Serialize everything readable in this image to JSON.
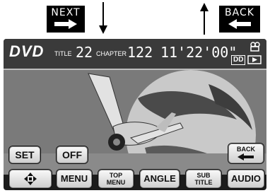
{
  "annotations": {
    "next_label": "NEXT",
    "back_label": "BACK"
  },
  "status_bar": {
    "source": "DVD",
    "title_label": "TITLE",
    "title_number": "22",
    "chapter_label": "CHAPTER",
    "chapter_number": "122",
    "elapsed_time": "11'22'00\"",
    "dolby_badge": "DD",
    "icons": [
      "camera-angle-icon",
      "screen-mode-icon"
    ]
  },
  "buttons": {
    "set": "SET",
    "off": "OFF",
    "back": "BACK",
    "menu": "MENU",
    "top_menu_line1": "TOP",
    "top_menu_line2": "MENU",
    "angle": "ANGLE",
    "sub_title_line1": "SUB",
    "sub_title_line2": "TITLE",
    "audio": "AUDIO",
    "move_icon": "four-way-arrow-icon"
  },
  "colors": {
    "status_bar": "#3a3a3a",
    "button_face": "#e8e8e8",
    "screen_bg": "#1c1c1c"
  }
}
